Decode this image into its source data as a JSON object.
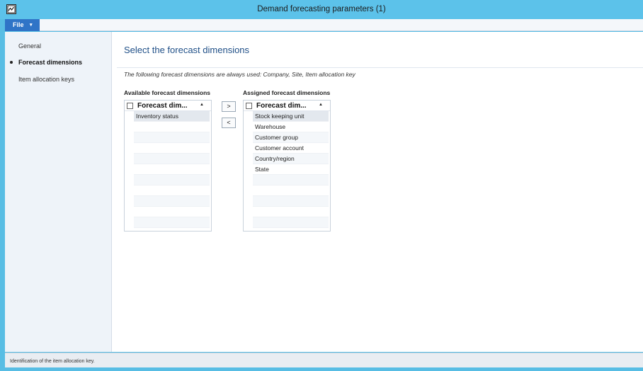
{
  "window": {
    "title": "Demand forecasting parameters (1)"
  },
  "menu": {
    "file_label": "File",
    "file_chevron": "▾"
  },
  "nav": {
    "items": [
      {
        "label": "General",
        "active": false
      },
      {
        "label": "Forecast dimensions",
        "active": true
      },
      {
        "label": "Item allocation keys",
        "active": false
      }
    ]
  },
  "main": {
    "title": "Select the forecast dimensions",
    "info": "The following forecast dimensions are always used: Company, Site, Item allocation key",
    "available": {
      "label": "Available forecast dimensions",
      "column_header": "Forecast dim...",
      "rows": [
        "Inventory status"
      ]
    },
    "assigned": {
      "label": "Assigned forecast dimensions",
      "column_header": "Forecast dim...",
      "rows": [
        "Stock keeping unit",
        "Warehouse",
        "Customer group",
        "Customer account",
        "Country/region",
        "State"
      ]
    },
    "buttons": {
      "add": ">",
      "remove": "<"
    },
    "sort_glyph": "▲"
  },
  "status": {
    "text": "Identification of the item allocation key."
  },
  "colors": {
    "title_bar": "#5cc2ea",
    "accent": "#2f74c7",
    "page_title": "#1f4f87"
  }
}
